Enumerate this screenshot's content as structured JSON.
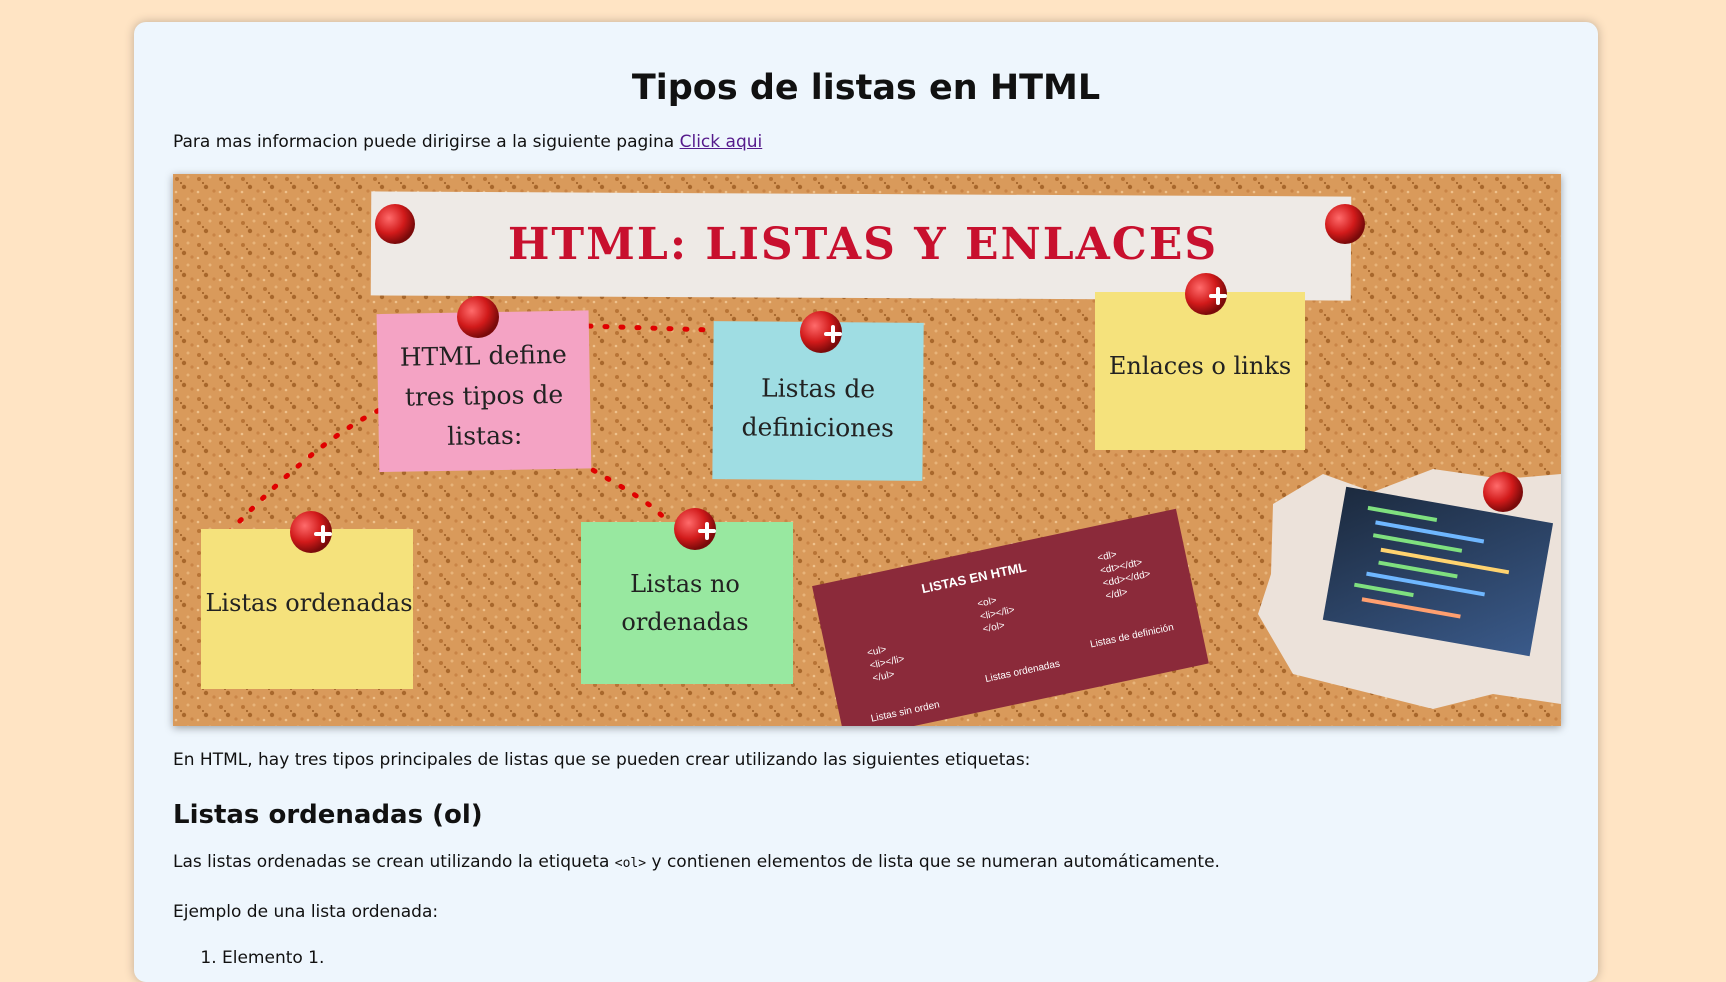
{
  "page": {
    "title": "Tipos de listas en HTML",
    "info_text": "Para mas informacion puede dirigirse a la siguiente pagina ",
    "info_link": "Click aqui",
    "intro": "En HTML, hay tres tipos principales de listas que se pueden crear utilizando las siguientes etiquetas:",
    "ol_heading": "Listas ordenadas (ol)",
    "ol_desc_before": "Las listas ordenadas se crean utilizando la etiqueta ",
    "ol_tag": "<ol>",
    "ol_desc_after": " y contienen elementos de lista que se numeran automáticamente.",
    "example_label": "Ejemplo de una lista ordenada:",
    "example_items": [
      "Elemento 1."
    ]
  },
  "hero": {
    "banner": "HTML: LISTAS Y ENLACES",
    "note_pink": [
      "HTML define",
      "tres tipos de",
      "listas:"
    ],
    "note_blue": [
      "Listas de",
      "definiciones"
    ],
    "note_yellow_top": [
      "Enlaces o links"
    ],
    "note_yellow_bottom": [
      "Listas ordenadas"
    ],
    "note_green": [
      "Listas no",
      "ordenadas"
    ],
    "red_card_title": "LISTAS EN HTML",
    "red_card_col1": [
      "<ul>",
      "<li></li>",
      "</ul>"
    ],
    "red_card_col2": [
      "<ol>",
      "<li></li>",
      "</ol>"
    ],
    "red_card_col3": [
      "<dl>",
      "<dt></dt>",
      "<dd></dd>",
      "</dl>"
    ],
    "red_card_labels": [
      "Listas sin orden",
      "Listas ordenadas",
      "Listas de definición"
    ],
    "colors": {
      "cork": "#d99a5b",
      "banner_text": "#c8102e",
      "pink": "#f4a3c4",
      "blue": "#9fdde3",
      "yellow": "#f5e27c",
      "green": "#98e8a0",
      "red_card": "#8b2a3a",
      "pin": "#d11a1a"
    }
  }
}
